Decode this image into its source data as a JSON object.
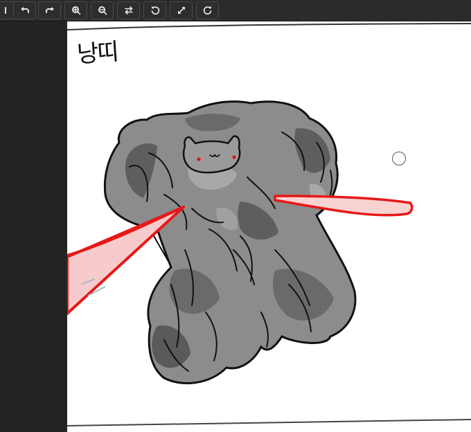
{
  "toolbar": {
    "buttons": [
      {
        "name": "menu-button",
        "icon": "menu-icon"
      },
      {
        "name": "undo-button",
        "icon": "undo-icon"
      },
      {
        "name": "redo-button",
        "icon": "redo-icon"
      },
      {
        "name": "zoom-in-button",
        "icon": "zoom-in-icon"
      },
      {
        "name": "zoom-out-button",
        "icon": "zoom-out-icon"
      },
      {
        "name": "flip-button",
        "icon": "swap-icon"
      },
      {
        "name": "rotate-left-button",
        "icon": "rotate-left-icon"
      },
      {
        "name": "fit-screen-button",
        "icon": "expand-icon"
      },
      {
        "name": "rotate-right-button",
        "icon": "rotate-right-icon"
      }
    ]
  },
  "canvas": {
    "handwritten_label": "낭띠",
    "colors": {
      "toolbar_bg": "#2b2b2b",
      "panel_bg": "#232323",
      "canvas_bg": "#ffffff",
      "ink": "#111111",
      "gray_fill": "#8a8a8a",
      "dark_gray": "#5a5a5a",
      "laser_red": "#e81818",
      "laser_pink": "#f8c8c8"
    }
  }
}
